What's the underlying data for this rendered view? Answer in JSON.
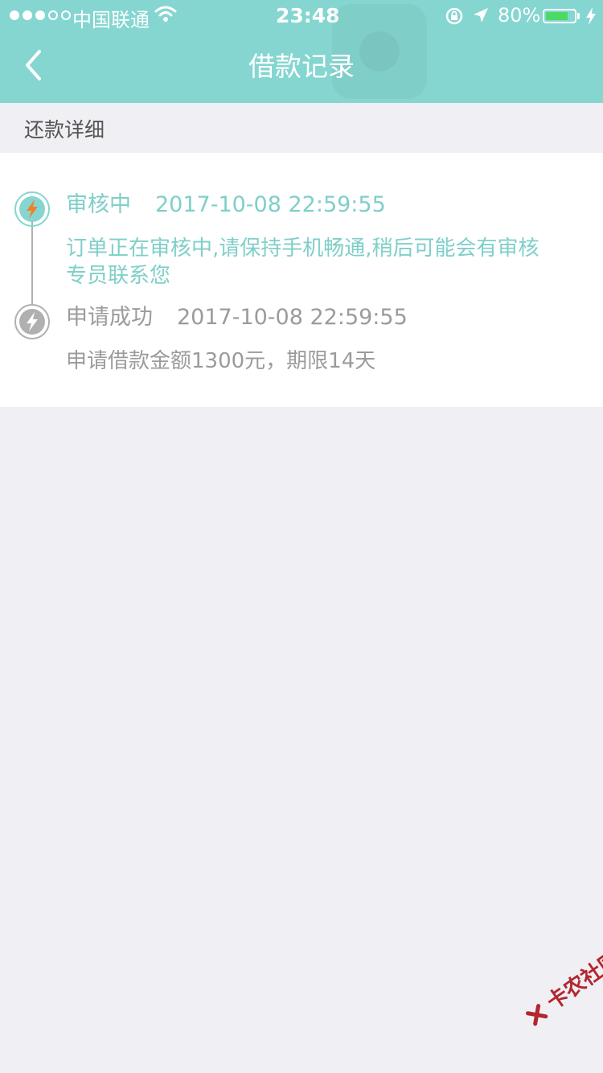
{
  "status_bar": {
    "carrier": "中国联通",
    "time": "23:48",
    "battery_percent": "80%",
    "battery_level": 0.8,
    "signal_strength": 3,
    "signal_max": 5
  },
  "nav": {
    "back_icon": "chevron-left-icon",
    "title": "借款记录"
  },
  "section": {
    "title": "还款详细"
  },
  "timeline": [
    {
      "status": "审核中",
      "datetime": "2017-10-08 22:59:55",
      "description": "订单正在审核中,请保持手机畅通,稍后可能会有审核专员联系您",
      "icon": "lightning-icon",
      "state": "active"
    },
    {
      "status": "申请成功",
      "datetime": "2017-10-08 22:59:55",
      "description": "申请借款金额1300元，期限14天",
      "icon": "lightning-icon",
      "state": "done"
    }
  ],
  "watermark": {
    "text": "卡农社区"
  },
  "colors": {
    "accent": "#85d6d0",
    "active_text": "#7fcfc9",
    "inactive": "#9b9b9b",
    "active_bolt": "#f07f2c",
    "battery": "#4cd964"
  }
}
